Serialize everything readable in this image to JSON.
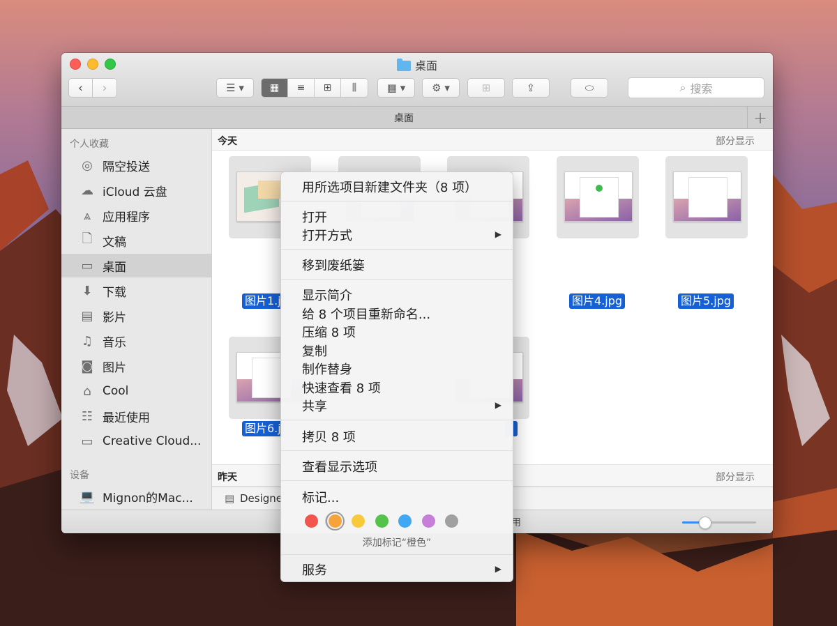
{
  "window": {
    "title": "桌面",
    "tab_title": "桌面"
  },
  "toolbar": {
    "search_placeholder": "搜索"
  },
  "sidebar": {
    "favorites_header": "个人收藏",
    "devices_header": "设备",
    "items": [
      {
        "label": "隔空投送",
        "icon": "airdrop-icon"
      },
      {
        "label": "iCloud 云盘",
        "icon": "cloud-icon"
      },
      {
        "label": "应用程序",
        "icon": "applications-icon"
      },
      {
        "label": "文稿",
        "icon": "document-icon"
      },
      {
        "label": "桌面",
        "icon": "desktop-icon",
        "selected": true
      },
      {
        "label": "下载",
        "icon": "download-icon"
      },
      {
        "label": "影片",
        "icon": "film-icon"
      },
      {
        "label": "音乐",
        "icon": "music-icon"
      },
      {
        "label": "图片",
        "icon": "camera-icon"
      },
      {
        "label": "Cool",
        "icon": "home-icon"
      },
      {
        "label": "最近使用",
        "icon": "recent-icon"
      },
      {
        "label": "Creative Cloud...",
        "icon": "folder-icon"
      }
    ],
    "devices": [
      {
        "label": "Mignon的Mac...",
        "icon": "laptop-icon"
      }
    ]
  },
  "sections": {
    "today": {
      "title": "今天",
      "more": "部分显示"
    },
    "yesterday": {
      "title": "昨天",
      "more": "部分显示"
    }
  },
  "files": {
    "f1": "图片1.j",
    "f4": "图片4.jpg",
    "f5": "图片5.jpg",
    "f6": "图片6.j"
  },
  "pathbar": {
    "item": "Designe"
  },
  "statusbar": {
    "text": "用",
    "zoom_level": 0.3
  },
  "context_menu": {
    "new_folder": "用所选项目新建文件夹（8 项）",
    "open": "打开",
    "open_with": "打开方式",
    "trash": "移到废纸篓",
    "info": "显示简介",
    "rename": "给 8 个项目重新命名...",
    "compress": "压缩 8 项",
    "duplicate": "复制",
    "alias": "制作替身",
    "quicklook": "快速查看 8 项",
    "share": "共享",
    "copy": "拷贝 8 项",
    "view_options": "查看显示选项",
    "tags": "标记...",
    "tag_caption": "添加标记“橙色”",
    "services": "服务",
    "tag_colors": [
      "#f2554e",
      "#f6a33b",
      "#f8c93a",
      "#53c34a",
      "#3fa7f3",
      "#c77ed8",
      "#a0a0a0"
    ],
    "selected_tag": "orange"
  }
}
